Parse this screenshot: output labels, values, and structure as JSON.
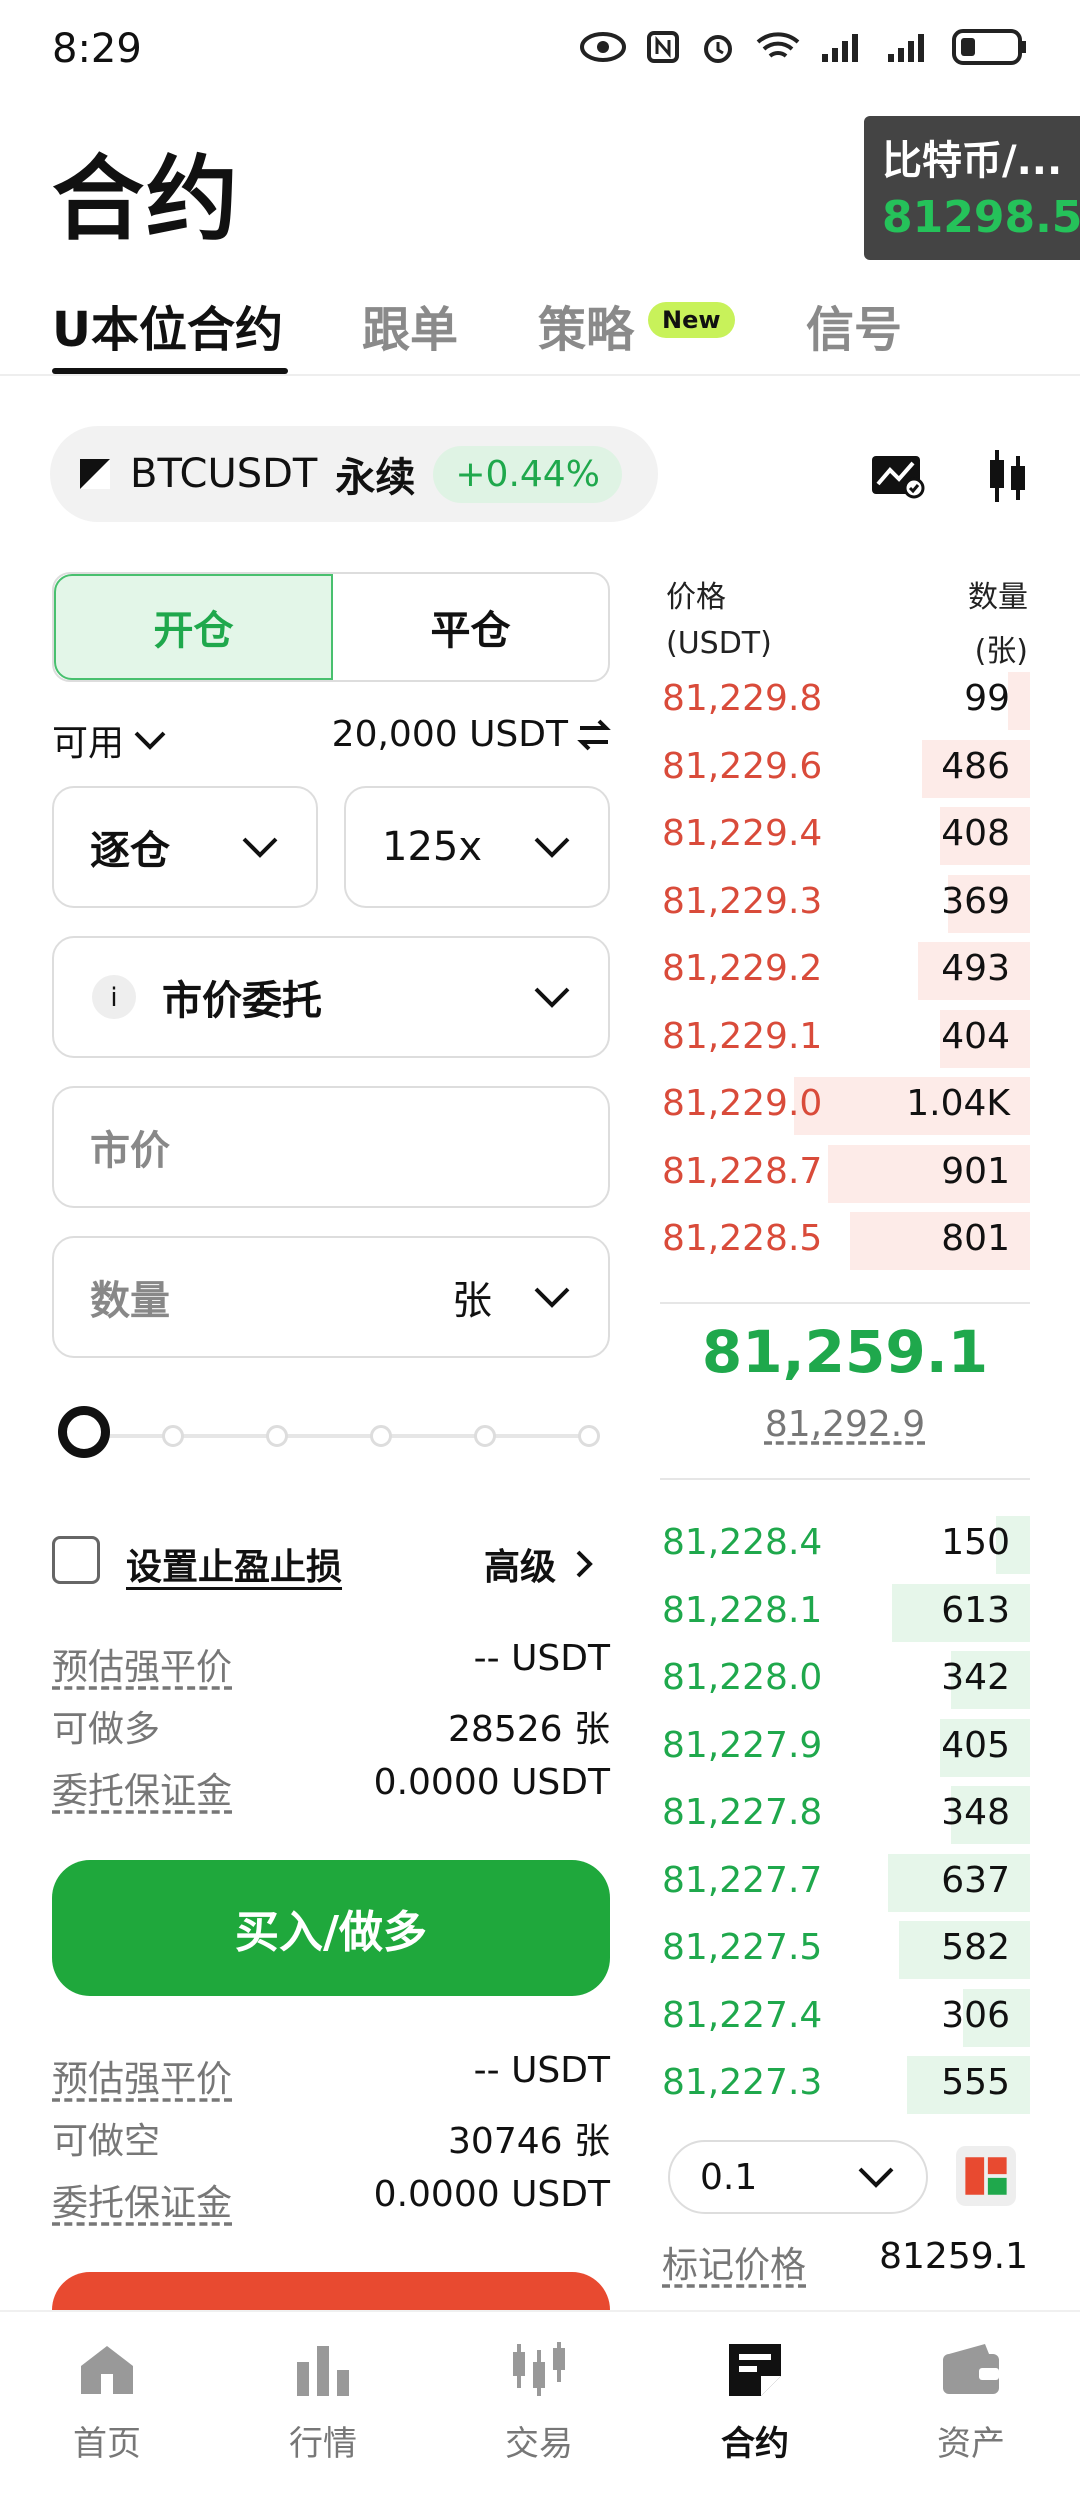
{
  "status": {
    "time": "8:29"
  },
  "page_title": "合约",
  "floating_ticker": {
    "name": "比特币/...",
    "price": "81298.5"
  },
  "tabs": [
    {
      "label": "U本位合约"
    },
    {
      "label": "跟单"
    },
    {
      "label": "策略"
    },
    {
      "label": "信号"
    }
  ],
  "new_badge": "New",
  "symbol": {
    "name": "BTCUSDT",
    "type": "永续",
    "change": "+0.44%"
  },
  "order_form": {
    "open_label": "开仓",
    "close_label": "平仓",
    "available_label": "可用",
    "available_value": "20,000 USDT",
    "margin_mode": "逐仓",
    "leverage": "125x",
    "order_type": "市价委托",
    "price_placeholder": "市价",
    "qty_placeholder": "数量",
    "qty_unit": "张",
    "tp_sl_label": "设置止盈止损",
    "advanced_label": "高级",
    "long_info": [
      {
        "k": "预估强平价",
        "v": "-- USDT"
      },
      {
        "k": "可做多",
        "v": "28526 张"
      },
      {
        "k": "委托保证金",
        "v": "0.0000 USDT"
      }
    ],
    "buy_label": "买入/做多",
    "short_info": [
      {
        "k": "预估强平价",
        "v": "-- USDT"
      },
      {
        "k": "可做空",
        "v": "30746 张"
      },
      {
        "k": "委托保证金",
        "v": "0.0000 USDT"
      }
    ]
  },
  "orderbook": {
    "price_head": "价格",
    "price_unit": "(USDT)",
    "qty_head": "数量",
    "qty_unit": "(张)",
    "asks": [
      {
        "price": "81,229.8",
        "qty": "99",
        "depth": 0.06
      },
      {
        "price": "81,229.6",
        "qty": "486",
        "depth": 0.29
      },
      {
        "price": "81,229.4",
        "qty": "408",
        "depth": 0.24
      },
      {
        "price": "81,229.3",
        "qty": "369",
        "depth": 0.22
      },
      {
        "price": "81,229.2",
        "qty": "493",
        "depth": 0.3
      },
      {
        "price": "81,229.1",
        "qty": "404",
        "depth": 0.24
      },
      {
        "price": "81,229.0",
        "qty": "1.04K",
        "depth": 0.63
      },
      {
        "price": "81,228.7",
        "qty": "901",
        "depth": 0.54
      },
      {
        "price": "81,228.5",
        "qty": "801",
        "depth": 0.48
      }
    ],
    "last_price": "81,259.1",
    "mark_price": "81,292.9",
    "bids": [
      {
        "price": "81,228.4",
        "qty": "150",
        "depth": 0.09
      },
      {
        "price": "81,228.1",
        "qty": "613",
        "depth": 0.37
      },
      {
        "price": "81,228.0",
        "qty": "342",
        "depth": 0.21
      },
      {
        "price": "81,227.9",
        "qty": "405",
        "depth": 0.24
      },
      {
        "price": "81,227.8",
        "qty": "348",
        "depth": 0.21
      },
      {
        "price": "81,227.7",
        "qty": "637",
        "depth": 0.38
      },
      {
        "price": "81,227.5",
        "qty": "582",
        "depth": 0.35
      },
      {
        "price": "81,227.4",
        "qty": "306",
        "depth": 0.18
      },
      {
        "price": "81,227.3",
        "qty": "555",
        "depth": 0.33
      }
    ],
    "step": "0.1",
    "mark_label": "标记价格",
    "mark_value": "81259.1"
  },
  "nav": [
    {
      "label": "首页"
    },
    {
      "label": "行情"
    },
    {
      "label": "交易"
    },
    {
      "label": "合约"
    },
    {
      "label": "资产"
    }
  ],
  "colors": {
    "green": "#1fa84c",
    "red": "#d94b3a",
    "accent_new": "#c8f25a"
  }
}
